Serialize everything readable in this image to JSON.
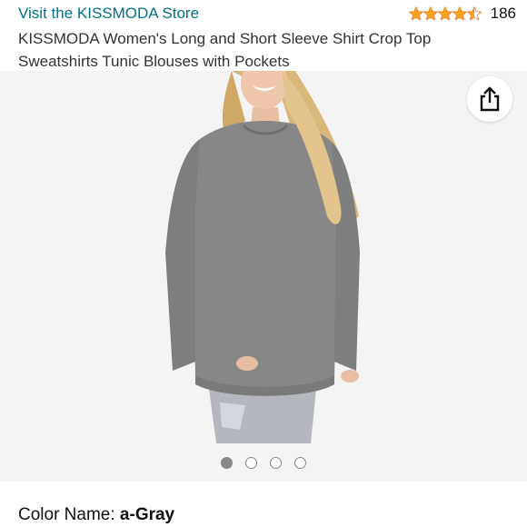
{
  "store": {
    "link_text": "Visit the KISSMODA Store"
  },
  "rating": {
    "stars": 4.5,
    "count": "186",
    "star_color": "#ffa41c"
  },
  "product": {
    "title": "KISSMODA Women's Long and Short Sleeve Shirt Crop Top Sweatshirts Tunic Blouses with Pockets"
  },
  "gallery": {
    "image_count": 4,
    "active_index": 0,
    "share_icon": "share-icon"
  },
  "variation": {
    "label": "Color Name: ",
    "value": "a-Gray"
  },
  "colors": {
    "link": "#007185",
    "gallery_bg": "#f4f4f4",
    "shirt": "#878787"
  }
}
